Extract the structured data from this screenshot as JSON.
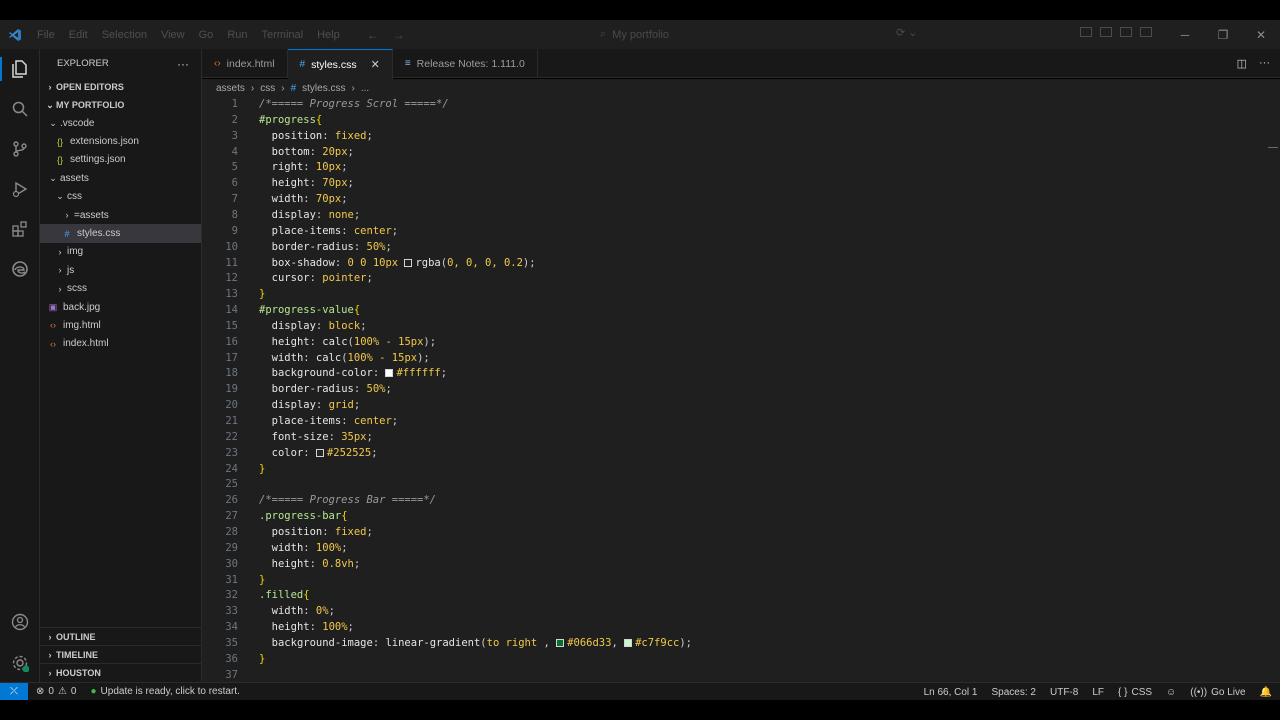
{
  "titlebar": {
    "menu": [
      "File",
      "Edit",
      "Selection",
      "View",
      "Go",
      "Run",
      "Terminal",
      "Help"
    ],
    "search_text": "My portfolio"
  },
  "sidebar": {
    "title": "EXPLORER",
    "open_editors": "OPEN EDITORS",
    "folder": "MY PORTFOLIO",
    "tree": [
      {
        "label": ".vscode",
        "kind": "folder-open",
        "depth": 1
      },
      {
        "label": "extensions.json",
        "kind": "json",
        "depth": 2
      },
      {
        "label": "settings.json",
        "kind": "json",
        "depth": 2
      },
      {
        "label": "assets",
        "kind": "folder-open",
        "depth": 1
      },
      {
        "label": "css",
        "kind": "folder-open",
        "depth": 2
      },
      {
        "label": "=assets",
        "kind": "folder-closed",
        "depth": 3
      },
      {
        "label": "styles.css",
        "kind": "css",
        "depth": 3,
        "active": true
      },
      {
        "label": "img",
        "kind": "folder-closed",
        "depth": 2
      },
      {
        "label": "js",
        "kind": "folder-closed",
        "depth": 2
      },
      {
        "label": "scss",
        "kind": "folder-closed",
        "depth": 2
      },
      {
        "label": "back.jpg",
        "kind": "image",
        "depth": 1
      },
      {
        "label": "img.html",
        "kind": "html",
        "depth": 1
      },
      {
        "label": "index.html",
        "kind": "html",
        "depth": 1
      }
    ],
    "outline": "OUTLINE",
    "timeline": "TIMELINE",
    "houston": "HOUSTON"
  },
  "tabs": [
    {
      "label": "index.html",
      "icon": "html",
      "active": false
    },
    {
      "label": "styles.css",
      "icon": "css",
      "active": true
    },
    {
      "label": "Release Notes: 1.111.0",
      "icon": "notes",
      "active": false
    }
  ],
  "breadcrumb": [
    "assets",
    "css",
    "styles.css",
    "..."
  ],
  "code_lines": [
    [
      [
        "c-com",
        "/*===== Progress Scrol =====*/"
      ]
    ],
    [
      [
        "c-sel2",
        "#progress"
      ],
      [
        "c-brace",
        "{"
      ]
    ],
    [
      [
        "",
        "  "
      ],
      [
        "c-prop",
        "position"
      ],
      [
        "",
        ": "
      ],
      [
        "c-val",
        "fixed"
      ],
      [
        "",
        ";"
      ]
    ],
    [
      [
        "",
        "  "
      ],
      [
        "c-prop",
        "bottom"
      ],
      [
        "",
        ": "
      ],
      [
        "c-val",
        "20px"
      ],
      [
        "",
        ";"
      ]
    ],
    [
      [
        "",
        "  "
      ],
      [
        "c-prop",
        "right"
      ],
      [
        "",
        ": "
      ],
      [
        "c-val",
        "10px"
      ],
      [
        "",
        ";"
      ]
    ],
    [
      [
        "",
        "  "
      ],
      [
        "c-prop",
        "height"
      ],
      [
        "",
        ": "
      ],
      [
        "c-val",
        "70px"
      ],
      [
        "",
        ";"
      ]
    ],
    [
      [
        "",
        "  "
      ],
      [
        "c-prop",
        "width"
      ],
      [
        "",
        ": "
      ],
      [
        "c-val",
        "70px"
      ],
      [
        "",
        ";"
      ]
    ],
    [
      [
        "",
        "  "
      ],
      [
        "c-prop",
        "display"
      ],
      [
        "",
        ": "
      ],
      [
        "c-val",
        "none"
      ],
      [
        "",
        ";"
      ]
    ],
    [
      [
        "",
        "  "
      ],
      [
        "c-prop",
        "place-items"
      ],
      [
        "",
        ": "
      ],
      [
        "c-val",
        "center"
      ],
      [
        "",
        ";"
      ]
    ],
    [
      [
        "",
        "  "
      ],
      [
        "c-prop",
        "border-radius"
      ],
      [
        "",
        ": "
      ],
      [
        "c-val",
        "50%"
      ],
      [
        "",
        ";"
      ]
    ],
    [
      [
        "",
        "  "
      ],
      [
        "c-prop",
        "box-shadow"
      ],
      [
        "",
        ": "
      ],
      [
        "c-val",
        "0 0 10px "
      ],
      [
        "swatch:transparent",
        ""
      ],
      [
        "c-prop",
        "rgba"
      ],
      [
        "",
        "("
      ],
      [
        "c-val",
        "0, 0, 0, 0.2"
      ],
      [
        "",
        ");"
      ]
    ],
    [
      [
        "",
        "  "
      ],
      [
        "c-prop",
        "cursor"
      ],
      [
        "",
        ": "
      ],
      [
        "c-val",
        "pointer"
      ],
      [
        "",
        ";"
      ]
    ],
    [
      [
        "c-brace",
        "}"
      ]
    ],
    [
      [
        "c-sel2",
        "#progress-value"
      ],
      [
        "c-brace",
        "{"
      ]
    ],
    [
      [
        "",
        "  "
      ],
      [
        "c-prop",
        "display"
      ],
      [
        "",
        ": "
      ],
      [
        "c-val",
        "block"
      ],
      [
        "",
        ";"
      ]
    ],
    [
      [
        "",
        "  "
      ],
      [
        "c-prop",
        "height"
      ],
      [
        "",
        ": "
      ],
      [
        "c-prop",
        "calc"
      ],
      [
        "",
        "("
      ],
      [
        "c-val",
        "100% - 15px"
      ],
      [
        "",
        ");"
      ]
    ],
    [
      [
        "",
        "  "
      ],
      [
        "c-prop",
        "width"
      ],
      [
        "",
        ": "
      ],
      [
        "c-prop",
        "calc"
      ],
      [
        "",
        "("
      ],
      [
        "c-val",
        "100% - 15px"
      ],
      [
        "",
        ");"
      ]
    ],
    [
      [
        "",
        "  "
      ],
      [
        "c-prop",
        "background-color"
      ],
      [
        "",
        ": "
      ],
      [
        "swatch:#ffffff",
        ""
      ],
      [
        "c-val",
        "#ffffff"
      ],
      [
        "",
        ";"
      ]
    ],
    [
      [
        "",
        "  "
      ],
      [
        "c-prop",
        "border-radius"
      ],
      [
        "",
        ": "
      ],
      [
        "c-val",
        "50%"
      ],
      [
        "",
        ";"
      ]
    ],
    [
      [
        "",
        "  "
      ],
      [
        "c-prop",
        "display"
      ],
      [
        "",
        ": "
      ],
      [
        "c-val",
        "grid"
      ],
      [
        "",
        ";"
      ]
    ],
    [
      [
        "",
        "  "
      ],
      [
        "c-prop",
        "place-items"
      ],
      [
        "",
        ": "
      ],
      [
        "c-val",
        "center"
      ],
      [
        "",
        ";"
      ]
    ],
    [
      [
        "",
        "  "
      ],
      [
        "c-prop",
        "font-size"
      ],
      [
        "",
        ": "
      ],
      [
        "c-val",
        "35px"
      ],
      [
        "",
        ";"
      ]
    ],
    [
      [
        "",
        "  "
      ],
      [
        "c-prop",
        "color"
      ],
      [
        "",
        ": "
      ],
      [
        "swatch:#252525",
        ""
      ],
      [
        "c-val",
        "#252525"
      ],
      [
        "",
        ";"
      ]
    ],
    [
      [
        "c-brace",
        "}"
      ]
    ],
    [],
    [
      [
        "c-com",
        "/*===== Progress Bar =====*/"
      ]
    ],
    [
      [
        "c-sel2",
        ".progress-bar"
      ],
      [
        "c-brace",
        "{"
      ]
    ],
    [
      [
        "",
        "  "
      ],
      [
        "c-prop",
        "position"
      ],
      [
        "",
        ": "
      ],
      [
        "c-val",
        "fixed"
      ],
      [
        "",
        ";"
      ]
    ],
    [
      [
        "",
        "  "
      ],
      [
        "c-prop",
        "width"
      ],
      [
        "",
        ": "
      ],
      [
        "c-val",
        "100%"
      ],
      [
        "",
        ";"
      ]
    ],
    [
      [
        "",
        "  "
      ],
      [
        "c-prop",
        "height"
      ],
      [
        "",
        ": "
      ],
      [
        "c-val",
        "0.8vh"
      ],
      [
        "",
        ";"
      ]
    ],
    [
      [
        "c-brace",
        "}"
      ]
    ],
    [
      [
        "c-sel2",
        ".filled"
      ],
      [
        "c-brace",
        "{"
      ]
    ],
    [
      [
        "",
        "  "
      ],
      [
        "c-prop",
        "width"
      ],
      [
        "",
        ": "
      ],
      [
        "c-val",
        "0%"
      ],
      [
        "",
        ";"
      ]
    ],
    [
      [
        "",
        "  "
      ],
      [
        "c-prop",
        "height"
      ],
      [
        "",
        ": "
      ],
      [
        "c-val",
        "100%"
      ],
      [
        "",
        ";"
      ]
    ],
    [
      [
        "",
        "  "
      ],
      [
        "c-prop",
        "background-image"
      ],
      [
        "",
        ": "
      ],
      [
        "c-prop",
        "linear-gradient"
      ],
      [
        "",
        "("
      ],
      [
        "c-val",
        "to right"
      ],
      [
        "",
        " , "
      ],
      [
        "swatch:#066d33",
        ""
      ],
      [
        "c-val",
        "#066d33"
      ],
      [
        "",
        ", "
      ],
      [
        "swatch:#c7f9cc",
        ""
      ],
      [
        "c-val",
        "#c7f9cc"
      ],
      [
        "",
        ");"
      ]
    ],
    [
      [
        "c-brace",
        "}"
      ]
    ],
    []
  ],
  "statusbar": {
    "errors": "0",
    "warnings": "0",
    "update": "Update is ready, click to restart.",
    "position": "Ln 66, Col 1",
    "spaces": "Spaces: 2",
    "encoding": "UTF-8",
    "eol": "LF",
    "language": "CSS",
    "golive": "Go Live"
  },
  "colors": {
    "accent": "#0078d4",
    "editor_bg": "#1f1f1f",
    "sidebar_bg": "#181818",
    "html_icon": "#e37933",
    "css_icon": "#42a5f5",
    "json_icon": "#cbcb41",
    "image_icon": "#a074c4"
  }
}
